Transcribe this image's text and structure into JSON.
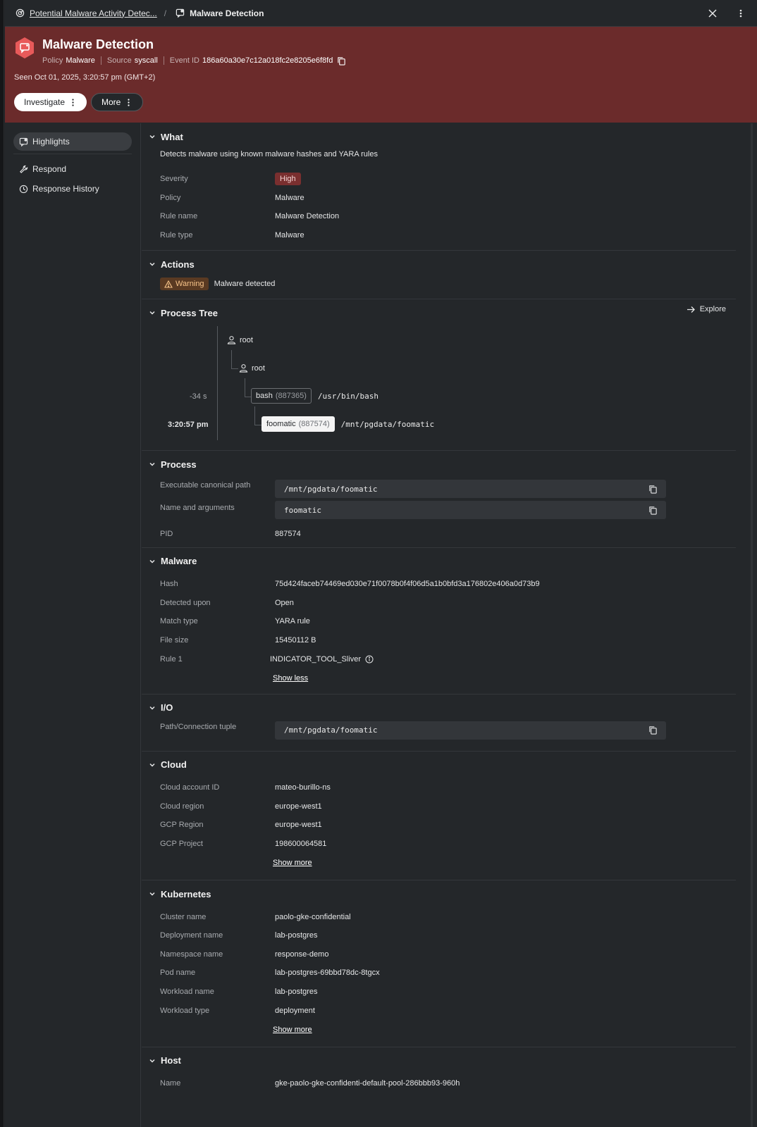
{
  "breadcrumb": {
    "parent": "Potential Malware Activity Detec...",
    "current": "Malware Detection"
  },
  "header": {
    "title": "Malware Detection",
    "policy_key": "Policy",
    "policy_value": "Malware",
    "source_key": "Source",
    "source_value": "syscall",
    "event_key": "Event ID",
    "event_value": "186a60a30e7c12a018fc2e8205e6f8fd",
    "seen": "Seen Oct 01, 2025, 3:20:57 pm (GMT+2)",
    "investigate_label": "Investigate",
    "more_label": "More"
  },
  "sidebar": {
    "items": [
      {
        "label": "Highlights",
        "icon": "highlights-icon"
      },
      {
        "label": "Respond",
        "icon": "wrench-icon"
      },
      {
        "label": "Response History",
        "icon": "clock-icon"
      }
    ]
  },
  "what": {
    "title": "What",
    "description": "Detects malware using known malware hashes and YARA rules",
    "severity_label": "Severity",
    "severity_value": "High",
    "policy_label": "Policy",
    "policy_value": "Malware",
    "rule_name_label": "Rule name",
    "rule_name_value": "Malware Detection",
    "rule_type_label": "Rule type",
    "rule_type_value": "Malware"
  },
  "actions": {
    "title": "Actions",
    "badge": "Warning",
    "text": "Malware detected"
  },
  "process_tree": {
    "title": "Process Tree",
    "explore_label": "Explore",
    "user1": "root",
    "user2": "root",
    "time1": "-34 s",
    "time2": "3:20:57 pm",
    "proc1_name": "bash",
    "proc1_pid": "(887365)",
    "proc1_path": "/usr/bin/bash",
    "proc2_name": "foomatic",
    "proc2_pid": "(887574)",
    "proc2_path": "/mnt/pgdata/foomatic"
  },
  "process": {
    "title": "Process",
    "exe_label": "Executable canonical path",
    "exe_value": "/mnt/pgdata/foomatic",
    "args_label": "Name and arguments",
    "args_value": "foomatic",
    "pid_label": "PID",
    "pid_value": "887574"
  },
  "malware": {
    "title": "Malware",
    "hash_label": "Hash",
    "hash_value": "75d424faceb74469ed030e71f0078b0f4f06d5a1b0bfd3a176802e406a0d73b9",
    "detected_label": "Detected upon",
    "detected_value": "Open",
    "match_label": "Match type",
    "match_value": "YARA rule",
    "size_label": "File size",
    "size_value": "15450112 B",
    "rule_label": "Rule 1",
    "rule_value": "INDICATOR_TOOL_Sliver",
    "toggle_label": "Show less"
  },
  "io": {
    "title": "I/O",
    "path_label": "Path/Connection tuple",
    "path_value": "/mnt/pgdata/foomatic"
  },
  "cloud": {
    "title": "Cloud",
    "account_label": "Cloud account ID",
    "account_value": "mateo-burillo-ns",
    "region_label": "Cloud region",
    "region_value": "europe-west1",
    "gcp_region_label": "GCP Region",
    "gcp_region_value": "europe-west1",
    "gcp_project_label": "GCP Project",
    "gcp_project_value": "198600064581",
    "toggle_label": "Show more"
  },
  "kubernetes": {
    "title": "Kubernetes",
    "cluster_label": "Cluster name",
    "cluster_value": "paolo-gke-confidential",
    "deployment_label": "Deployment name",
    "deployment_value": "lab-postgres",
    "namespace_label": "Namespace name",
    "namespace_value": "response-demo",
    "pod_label": "Pod name",
    "pod_value": "lab-postgres-69bbd78dc-8tgcx",
    "workload_label": "Workload name",
    "workload_value": "lab-postgres",
    "workload_type_label": "Workload type",
    "workload_type_value": "deployment",
    "toggle_label": "Show more"
  },
  "host": {
    "title": "Host",
    "name_label": "Name",
    "name_value": "gke-paolo-gke-confidenti-default-pool-286bbb93-960h"
  },
  "colors": {
    "banner": "#6b2b2b",
    "severity_high": "#7a2f2f",
    "warning": "#5a3a22"
  }
}
